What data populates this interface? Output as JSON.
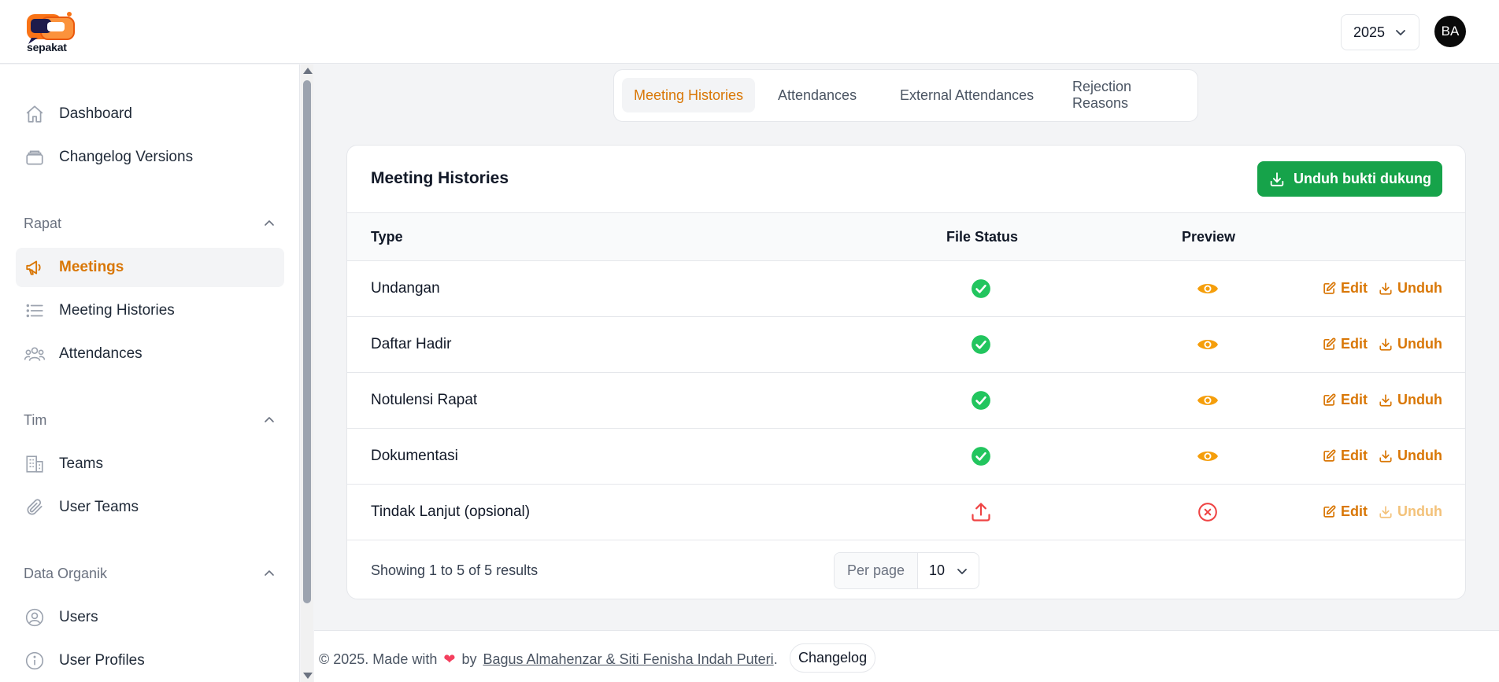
{
  "header": {
    "logo_text": "sepakat",
    "year": "2025",
    "avatar_initials": "BA"
  },
  "sidebar": {
    "top_items": [
      {
        "label": "Dashboard",
        "icon": "home-icon"
      },
      {
        "label": "Changelog Versions",
        "icon": "stack-icon"
      }
    ],
    "groups": [
      {
        "title": "Rapat",
        "items": [
          {
            "label": "Meetings",
            "icon": "megaphone-icon",
            "active": true
          },
          {
            "label": "Meeting Histories",
            "icon": "list-icon"
          },
          {
            "label": "Attendances",
            "icon": "users-icon"
          }
        ]
      },
      {
        "title": "Tim",
        "items": [
          {
            "label": "Teams",
            "icon": "building-icon"
          },
          {
            "label": "User Teams",
            "icon": "paperclip-icon"
          }
        ]
      },
      {
        "title": "Data Organik",
        "items": [
          {
            "label": "Users",
            "icon": "user-circle-icon"
          },
          {
            "label": "User Profiles",
            "icon": "info-icon"
          }
        ]
      }
    ]
  },
  "tabs": [
    {
      "label": "Meeting Histories",
      "active": true
    },
    {
      "label": "Attendances"
    },
    {
      "label": "External Attendances"
    },
    {
      "label": "Rejection Reasons"
    }
  ],
  "card": {
    "title": "Meeting Histories",
    "download_label": "Unduh bukti dukung",
    "columns": [
      "Type",
      "File Status",
      "Preview"
    ],
    "rows": [
      {
        "type": "Undangan",
        "status": "uploaded",
        "preview": "available",
        "edit": "Edit",
        "unduh": "Unduh",
        "unduh_enabled": true
      },
      {
        "type": "Daftar Hadir",
        "status": "uploaded",
        "preview": "available",
        "edit": "Edit",
        "unduh": "Unduh",
        "unduh_enabled": true
      },
      {
        "type": "Notulensi Rapat",
        "status": "uploaded",
        "preview": "available",
        "edit": "Edit",
        "unduh": "Unduh",
        "unduh_enabled": true
      },
      {
        "type": "Dokumentasi",
        "status": "uploaded",
        "preview": "available",
        "edit": "Edit",
        "unduh": "Unduh",
        "unduh_enabled": true
      },
      {
        "type": "Tindak Lanjut (opsional)",
        "status": "missing",
        "preview": "unavailable",
        "edit": "Edit",
        "unduh": "Unduh",
        "unduh_enabled": false
      }
    ],
    "showing": "Showing 1 to 5 of 5 results",
    "per_page_label": "Per page",
    "per_page_value": "10"
  },
  "footer": {
    "prefix": "© 2025. Made with",
    "by": "by",
    "authors": "Bagus Almahenzar & Siti Fenisha Indah Puteri",
    "changelog": "Changelog"
  },
  "colors": {
    "accent": "#d97706",
    "success": "#22c55e",
    "primary_button": "#16a34a",
    "danger": "#ef4444"
  }
}
